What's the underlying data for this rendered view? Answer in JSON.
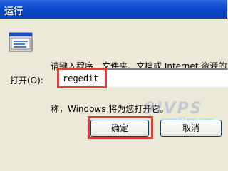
{
  "window": {
    "title": "运行"
  },
  "description": {
    "line1": "请键入程序、文件夹、文档或 Internet 资源的名称，",
    "line2": "称，Windows 将为您打开它。"
  },
  "open_field": {
    "label": "打开(O):",
    "value": "regedit"
  },
  "buttons": {
    "ok": "确定",
    "cancel": "取消"
  },
  "watermark": {
    "big": "9IVPS",
    "small": "www.91vps.com"
  },
  "colors": {
    "titlebar": "#0a46c8",
    "highlight": "#e23b3b",
    "dialog_bg": "#ece9d8"
  }
}
